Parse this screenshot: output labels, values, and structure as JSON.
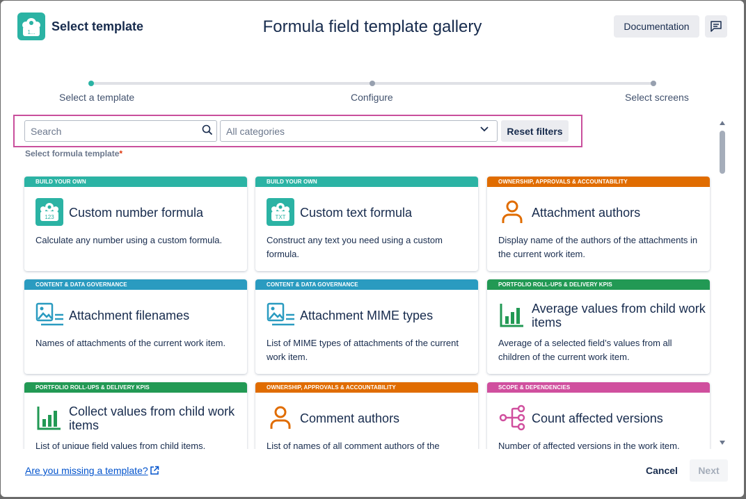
{
  "header": {
    "app_title": "Select template",
    "gallery_title": "Formula field template gallery",
    "documentation_label": "Documentation",
    "logo_icon": "robot-icon",
    "feedback_icon": "feedback-icon"
  },
  "stepper": {
    "steps": [
      "Select a template",
      "Configure",
      "Select screens"
    ],
    "active_index": 0
  },
  "filters": {
    "search_placeholder": "Search",
    "category_value": "All categories",
    "reset_label": "Reset filters"
  },
  "section_label": "Select formula template",
  "required_mark": "*",
  "colors": {
    "teal": "#2bb3a4",
    "blue": "#2a9bc0",
    "orange": "#e06c00",
    "green": "#229954",
    "pink": "#d04f9e",
    "highlight": "#c94f9c"
  },
  "cards": [
    {
      "category": "BUILD YOUR OWN",
      "title": "Custom number formula",
      "desc": "Calculate any number using a custom formula.",
      "icon": "robot-123-icon"
    },
    {
      "category": "BUILD YOUR OWN",
      "title": "Custom text formula",
      "desc": "Construct any text you need using a custom formula.",
      "icon": "robot-txt-icon"
    },
    {
      "category": "OWNERSHIP, APPROVALS & ACCOUNTABILITY",
      "title": "Attachment authors",
      "desc": "Display name of the authors of the attachments in the current work item.",
      "icon": "person-icon"
    },
    {
      "category": "CONTENT & DATA GOVERNANCE",
      "title": "Attachment filenames",
      "desc": "Names of attachments of the current work item.",
      "icon": "image-list-icon"
    },
    {
      "category": "CONTENT & DATA GOVERNANCE",
      "title": "Attachment MIME types",
      "desc": "List of MIME types of attachments of the current work item.",
      "icon": "image-list-icon"
    },
    {
      "category": "PORTFOLIO ROLL-UPS & DELIVERY KPIS",
      "title": "Average values from child work items",
      "desc": "Average of a selected field’s values from all children of the current work item.",
      "icon": "bar-chart-icon"
    },
    {
      "category": "PORTFOLIO ROLL-UPS & DELIVERY KPIS",
      "title": "Collect values from child work items",
      "desc": "List of unique field values from child items.",
      "icon": "bar-chart-icon"
    },
    {
      "category": "OWNERSHIP, APPROVALS & ACCOUNTABILITY",
      "title": "Comment authors",
      "desc": "List of names of all comment authors of the",
      "icon": "person-icon"
    },
    {
      "category": "SCOPE & DEPENDENCIES",
      "title": "Count affected versions",
      "desc": "Number of affected versions in the work item.",
      "icon": "branch-icon"
    }
  ],
  "footer": {
    "missing_link": "Are you missing a template?",
    "cancel_label": "Cancel",
    "next_label": "Next"
  }
}
